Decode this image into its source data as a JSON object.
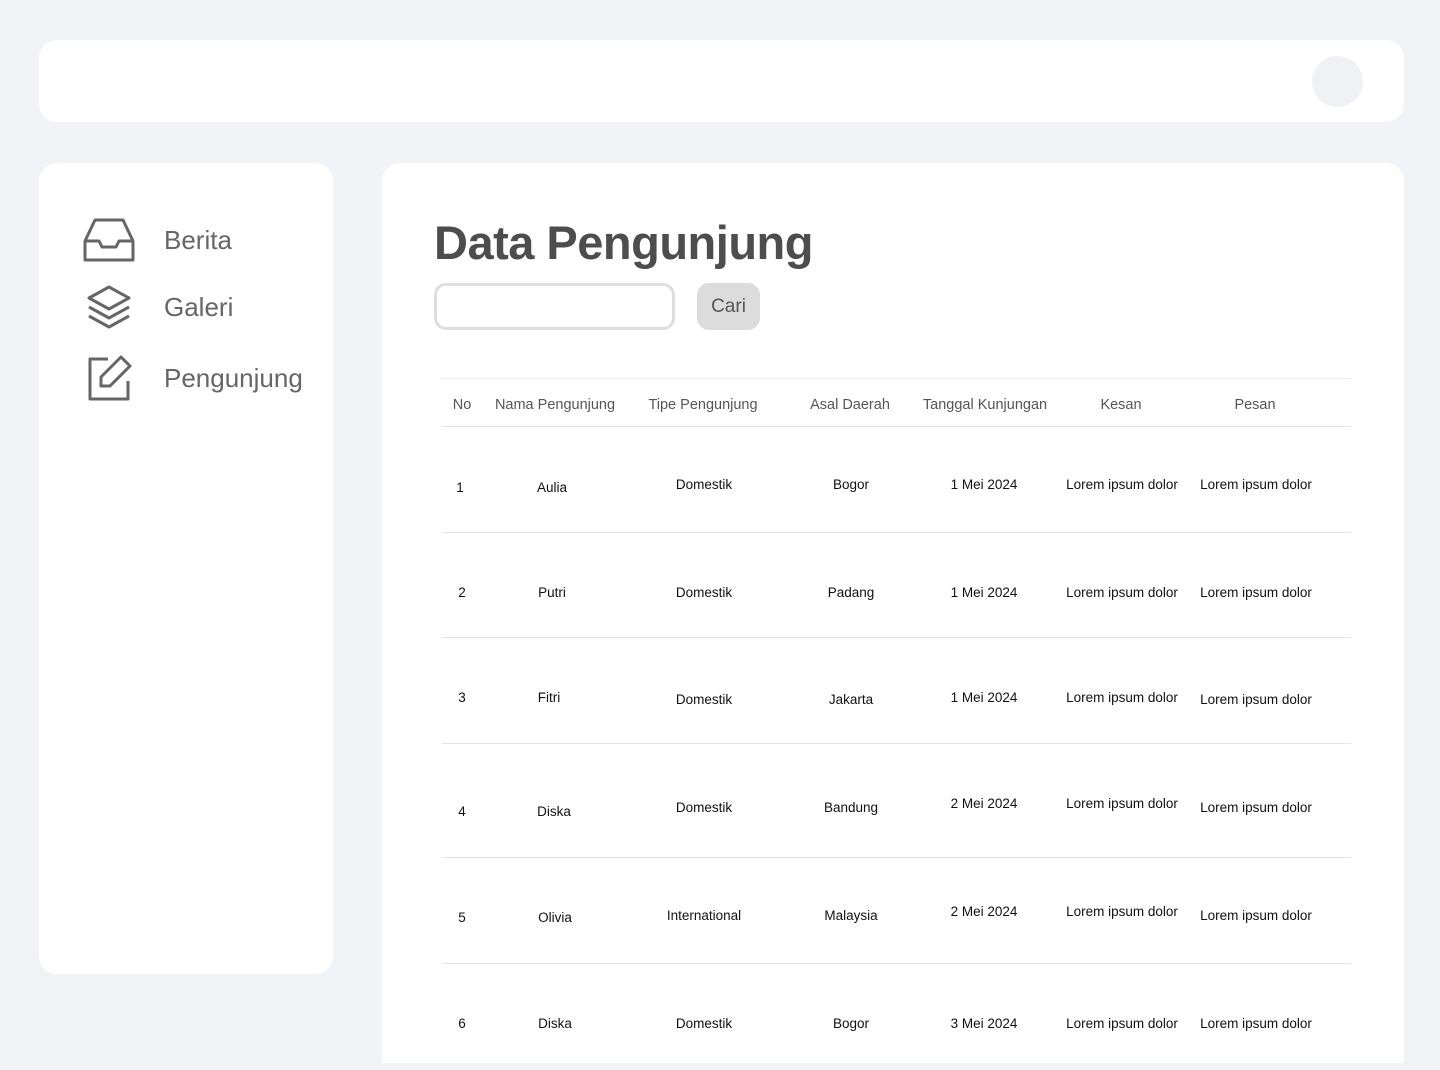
{
  "sidebar": {
    "items": [
      {
        "label": "Berita",
        "icon": "inbox-icon"
      },
      {
        "label": "Galeri",
        "icon": "layers-icon"
      },
      {
        "label": "Pengunjung",
        "icon": "edit-icon"
      }
    ]
  },
  "main": {
    "title": "Data Pengunjung",
    "search": {
      "placeholder": "",
      "value": "",
      "button_label": "Cari"
    },
    "table": {
      "headers": [
        "No",
        "Nama Pengunjung",
        "Tipe Pengunjung",
        "Asal Daerah",
        "Tanggal Kunjungan",
        "Kesan",
        "Pesan"
      ],
      "rows": [
        [
          "1",
          "Aulia",
          "Domestik",
          "Bogor",
          "1 Mei 2024",
          "Lorem ipsum dolor",
          "Lorem ipsum dolor"
        ],
        [
          "2",
          "Putri",
          "Domestik",
          "Padang",
          "1 Mei 2024",
          "Lorem ipsum dolor",
          "Lorem ipsum dolor"
        ],
        [
          "3",
          "Fitri",
          "Domestik",
          "Jakarta",
          "1 Mei 2024",
          "Lorem ipsum dolor",
          "Lorem ipsum dolor"
        ],
        [
          "4",
          "Diska",
          "Domestik",
          "Bandung",
          "2 Mei 2024",
          "Lorem ipsum dolor",
          "Lorem ipsum dolor"
        ],
        [
          "5",
          "Olivia",
          "International",
          "Malaysia",
          "2 Mei 2024",
          "Lorem ipsum dolor",
          "Lorem ipsum dolor"
        ],
        [
          "6",
          "Diska",
          "Domestik",
          "Bogor",
          "3 Mei 2024",
          "Lorem ipsum dolor",
          "Lorem ipsum dolor"
        ]
      ]
    }
  }
}
